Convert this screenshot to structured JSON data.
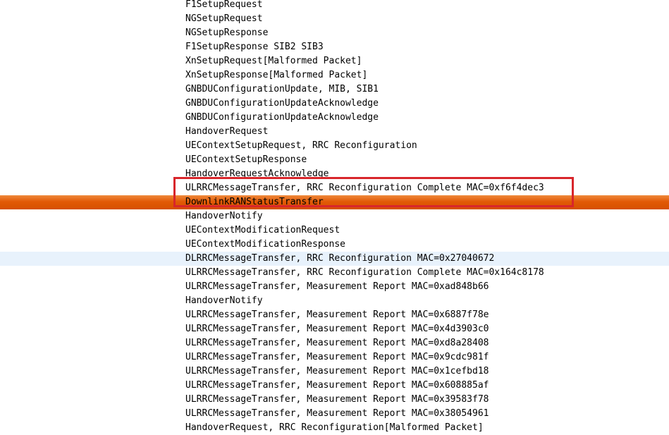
{
  "packet_list": {
    "rows": [
      {
        "info": "F1SetupRequest",
        "state": "normal"
      },
      {
        "info": "NGSetupRequest",
        "state": "normal"
      },
      {
        "info": "NGSetupResponse",
        "state": "normal"
      },
      {
        "info": "F1SetupResponse SIB2 SIB3",
        "state": "normal"
      },
      {
        "info": "XnSetupRequest[Malformed Packet]",
        "state": "normal"
      },
      {
        "info": "XnSetupResponse[Malformed Packet]",
        "state": "normal"
      },
      {
        "info": "GNBDUConfigurationUpdate, MIB, SIB1",
        "state": "normal"
      },
      {
        "info": "GNBDUConfigurationUpdateAcknowledge",
        "state": "normal"
      },
      {
        "info": "GNBDUConfigurationUpdateAcknowledge",
        "state": "normal"
      },
      {
        "info": "HandoverRequest",
        "state": "normal"
      },
      {
        "info": "UEContextSetupRequest, RRC Reconfiguration",
        "state": "normal"
      },
      {
        "info": "UEContextSetupResponse",
        "state": "normal"
      },
      {
        "info": "HandoverRequestAcknowledge",
        "state": "normal"
      },
      {
        "info": "ULRRCMessageTransfer, RRC Reconfiguration Complete MAC=0xf6f4dec3",
        "state": "normal"
      },
      {
        "info": "DownlinkRANStatusTransfer",
        "state": "selected"
      },
      {
        "info": "HandoverNotify",
        "state": "normal"
      },
      {
        "info": "UEContextModificationRequest",
        "state": "normal"
      },
      {
        "info": "UEContextModificationResponse",
        "state": "normal"
      },
      {
        "info": "DLRRCMessageTransfer, RRC Reconfiguration MAC=0x27040672",
        "state": "hover"
      },
      {
        "info": "ULRRCMessageTransfer, RRC Reconfiguration Complete MAC=0x164c8178",
        "state": "normal"
      },
      {
        "info": "ULRRCMessageTransfer, Measurement Report MAC=0xad848b66",
        "state": "normal"
      },
      {
        "info": "HandoverNotify",
        "state": "normal"
      },
      {
        "info": "ULRRCMessageTransfer, Measurement Report MAC=0x6887f78e",
        "state": "normal"
      },
      {
        "info": "ULRRCMessageTransfer, Measurement Report MAC=0x4d3903c0",
        "state": "normal"
      },
      {
        "info": "ULRRCMessageTransfer, Measurement Report MAC=0xd8a28408",
        "state": "normal"
      },
      {
        "info": "ULRRCMessageTransfer, Measurement Report MAC=0x9cdc981f",
        "state": "normal"
      },
      {
        "info": "ULRRCMessageTransfer, Measurement Report MAC=0x1cefbd18",
        "state": "normal"
      },
      {
        "info": "ULRRCMessageTransfer, Measurement Report MAC=0x608885af",
        "state": "normal"
      },
      {
        "info": "ULRRCMessageTransfer, Measurement Report MAC=0x39583f78",
        "state": "normal"
      },
      {
        "info": "ULRRCMessageTransfer, Measurement Report MAC=0x38054961",
        "state": "normal"
      },
      {
        "info": "HandoverRequest, RRC Reconfiguration[Malformed Packet]",
        "state": "normal"
      }
    ]
  },
  "colors": {
    "selected_row": "#e25a06",
    "hover_row": "#e8f2fc",
    "annotation_box": "#d8262b"
  }
}
